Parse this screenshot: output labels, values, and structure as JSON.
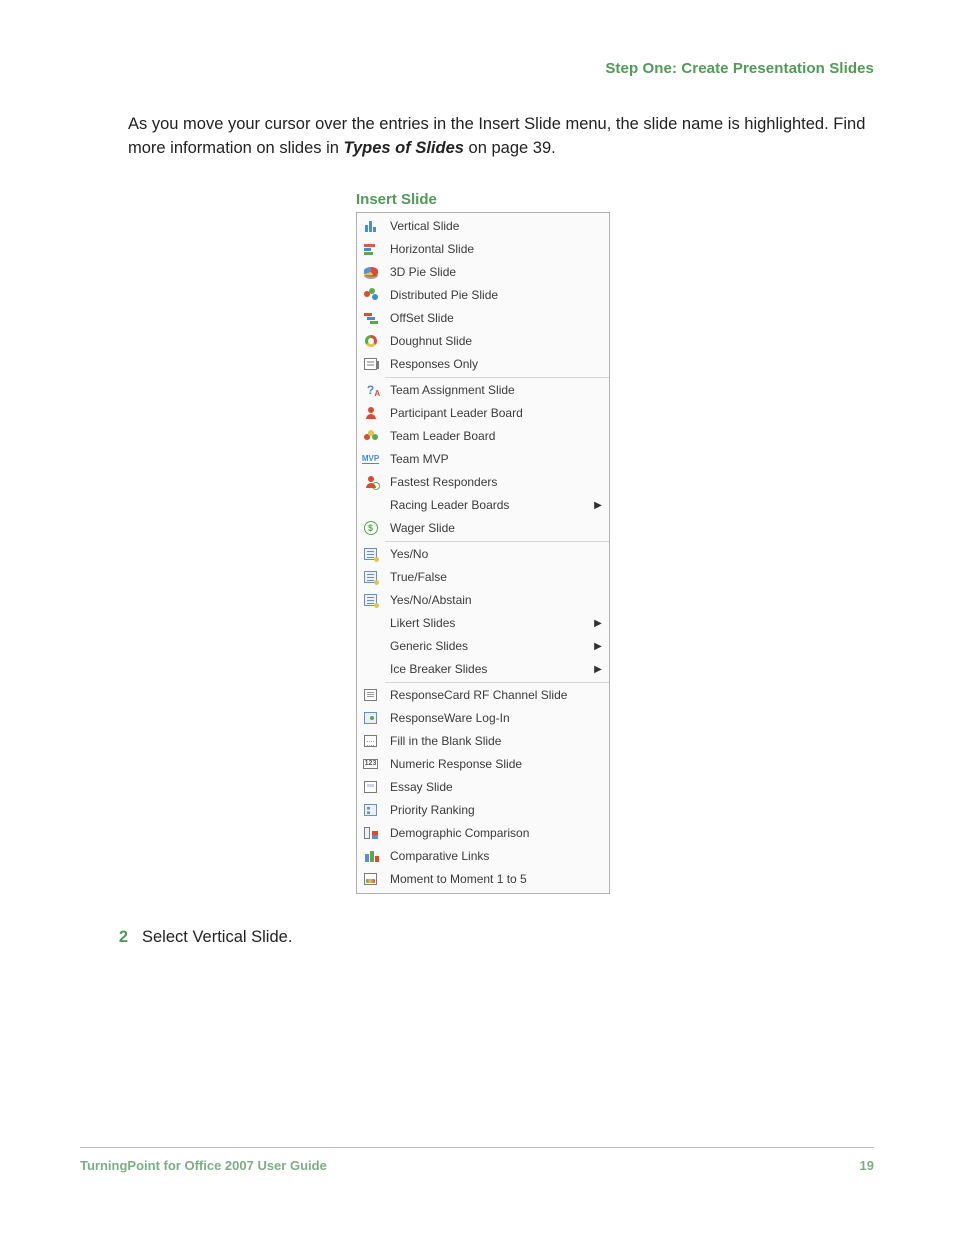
{
  "header": {
    "title": "Step One: Create Presentation Slides"
  },
  "intro": {
    "pre": "As you move your cursor over the entries in the Insert Slide menu, the slide name is highlighted. Find more information on slides in ",
    "link": "Types of Slides",
    "post": " on page 39."
  },
  "menu": {
    "title": "Insert Slide",
    "groups": [
      [
        {
          "label": "Vertical Slide",
          "icon": "vbar-icon",
          "submenu": false
        },
        {
          "label": "Horizontal Slide",
          "icon": "hbar-icon",
          "submenu": false
        },
        {
          "label": "3D Pie Slide",
          "icon": "pie3d-icon",
          "submenu": false
        },
        {
          "label": "Distributed Pie Slide",
          "icon": "pied-icon",
          "submenu": false
        },
        {
          "label": "OffSet Slide",
          "icon": "offset-icon",
          "submenu": false
        },
        {
          "label": "Doughnut Slide",
          "icon": "donut-icon",
          "submenu": false
        },
        {
          "label": "Responses Only",
          "icon": "resp-icon",
          "submenu": false
        }
      ],
      [
        {
          "label": "Team Assignment Slide",
          "icon": "qa-icon",
          "submenu": false
        },
        {
          "label": "Participant Leader Board",
          "icon": "pleader-icon",
          "submenu": false
        },
        {
          "label": "Team Leader Board",
          "icon": "tleader-icon",
          "submenu": false
        },
        {
          "label": "Team MVP",
          "icon": "mvp-icon",
          "submenu": false
        },
        {
          "label": "Fastest Responders",
          "icon": "fast-icon",
          "submenu": false
        },
        {
          "label": "Racing Leader Boards",
          "icon": "",
          "submenu": true
        },
        {
          "label": "Wager Slide",
          "icon": "wager-icon",
          "submenu": false
        }
      ],
      [
        {
          "label": "Yes/No",
          "icon": "list-icon",
          "submenu": false
        },
        {
          "label": "True/False",
          "icon": "list-icon",
          "submenu": false
        },
        {
          "label": "Yes/No/Abstain",
          "icon": "list-icon",
          "submenu": false
        },
        {
          "label": "Likert Slides",
          "icon": "",
          "submenu": true
        },
        {
          "label": "Generic Slides",
          "icon": "",
          "submenu": true
        },
        {
          "label": "Ice Breaker Slides",
          "icon": "",
          "submenu": true
        }
      ],
      [
        {
          "label": "ResponseCard RF Channel Slide",
          "icon": "card-icon",
          "submenu": false
        },
        {
          "label": "ResponseWare Log-In",
          "icon": "login-icon",
          "submenu": false
        },
        {
          "label": "Fill in the Blank Slide",
          "icon": "blank-icon",
          "submenu": false
        },
        {
          "label": "Numeric Response Slide",
          "icon": "num-icon",
          "submenu": false
        },
        {
          "label": "Essay Slide",
          "icon": "essay-icon",
          "submenu": false
        },
        {
          "label": "Priority Ranking",
          "icon": "rank-icon",
          "submenu": false
        },
        {
          "label": "Demographic Comparison",
          "icon": "demo-icon",
          "submenu": false
        },
        {
          "label": "Comparative Links",
          "icon": "comp-icon",
          "submenu": false
        },
        {
          "label": "Moment to Moment 1 to 5",
          "icon": "mom-icon",
          "submenu": false
        }
      ]
    ]
  },
  "step": {
    "number": "2",
    "text": "Select Vertical Slide."
  },
  "footer": {
    "left": "TurningPoint for Office 2007 User Guide",
    "right": "19"
  }
}
